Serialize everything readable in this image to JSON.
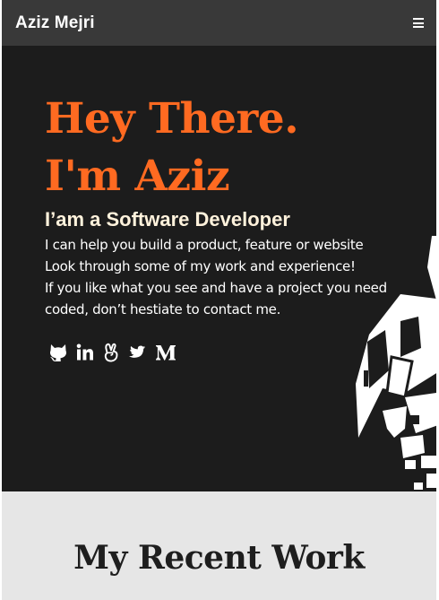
{
  "navbar": {
    "brand": "Aziz Mejri",
    "menu_icon": "hamburger-menu-icon"
  },
  "hero": {
    "title_line1": "Hey There.",
    "title_line2": "I'm Aziz",
    "subtitle": "I’am a Software Developer",
    "paragraphs": [
      "I can help you build a product, feature or website",
      "Look through some of my work and experience!",
      "If you like what you see and have a project you need coded, don’t hestiate to contact me."
    ],
    "socials": [
      "github-icon",
      "linkedin-icon",
      "angellist-icon",
      "twitter-icon",
      "medium-icon"
    ]
  },
  "work": {
    "title": "My Recent Work"
  },
  "colors": {
    "accent": "#ff6a21",
    "navbar": "#393939",
    "hero_bg": "#1c1c1c",
    "subtitle": "#fff2dc",
    "section_bg": "#e6e6e6"
  }
}
